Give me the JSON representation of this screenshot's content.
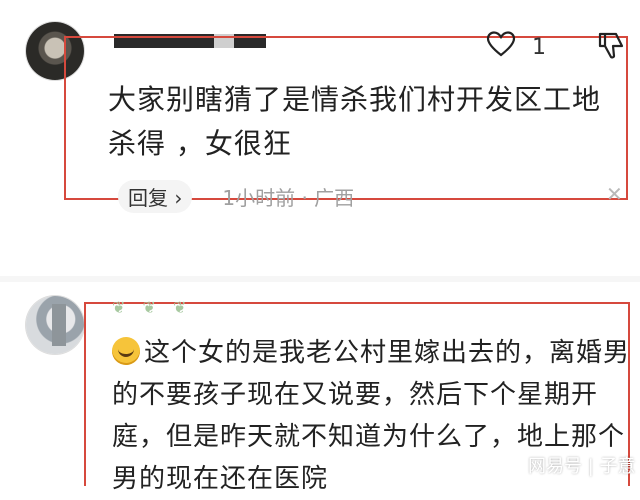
{
  "comment1": {
    "likes": "1",
    "text": "大家别瞎猜了是情杀我们村开发区工地杀得 ，女很狂",
    "reply_label": "回复 ›",
    "meta": "1小时前 · 广西"
  },
  "comment2": {
    "text": "这个女的是我老公村里嫁出去的，离婚男的不要孩子现在又说要，然后下个星期开庭，但是昨天就不知道为什么了，地上那个男的现在还在医院"
  },
  "watermark": "网易号 | 子意",
  "colors": {
    "highlight_box": "#d6493d"
  },
  "icons": [
    "heart-icon",
    "thumb-down-icon",
    "close-icon",
    "laughing-emoji-icon"
  ]
}
